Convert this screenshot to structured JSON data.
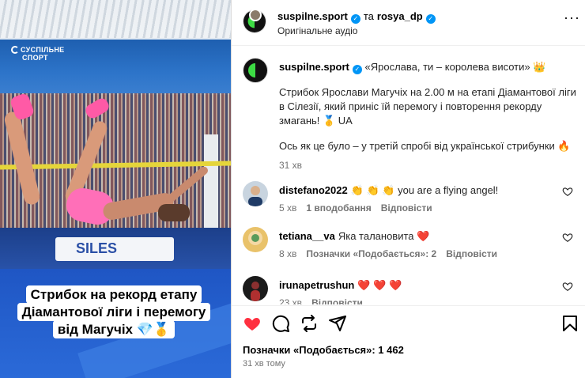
{
  "media": {
    "broadcaster_line1": "СУСПІЛЬНЕ",
    "broadcaster_line2": "СПОРТ",
    "board_text": "SILES",
    "caption_lines": [
      "Стрибок на рекорд етапу",
      "Діамантової ліги і перемогу",
      "від Магучіх 💎🥇"
    ]
  },
  "header": {
    "author": "suspilne.sport",
    "and_text": "та",
    "coauthor": "rosya_dp",
    "subtitle": "Оригінальне аудіо",
    "more_icon": "more-horizontal-icon"
  },
  "post": {
    "author": "suspilne.sport",
    "quote": "«Ярослава, ти – королева висоти» 👑",
    "paragraph1": "Стрибок Ярослави Магучіх на 2.00 м на етапі Діамантової ліги в Сілезії, який приніс їй перемогу і повторення рекорду змагань! 🥇 UA",
    "paragraph2": "Ось як це було – у третій спробі від української стрибунки 🔥",
    "time": "31 хв"
  },
  "comments": [
    {
      "user": "distefano2022",
      "text": "👏 👏 👏 you are a flying angel!",
      "time": "5 хв",
      "likes_label": "1 вподобання",
      "reply_label": "Відповісти"
    },
    {
      "user": "tetiana__va",
      "text": "Яка талановита ❤️",
      "time": "8 хв",
      "likes_label": "Позначки «Подобається»: 2",
      "reply_label": "Відповісти"
    },
    {
      "user": "irunapetrushun",
      "text": "❤️ ❤️ ❤️",
      "time": "23 хв",
      "likes_label": "",
      "reply_label": "Відповісти"
    }
  ],
  "actions": {
    "likes_text": "Позначки «Подобається»: 1 462",
    "posted_ago": "31 хв тому"
  },
  "colors": {
    "verified": "#0095f6",
    "like_red": "#ff3040",
    "logo_green": "#3ddc44"
  }
}
